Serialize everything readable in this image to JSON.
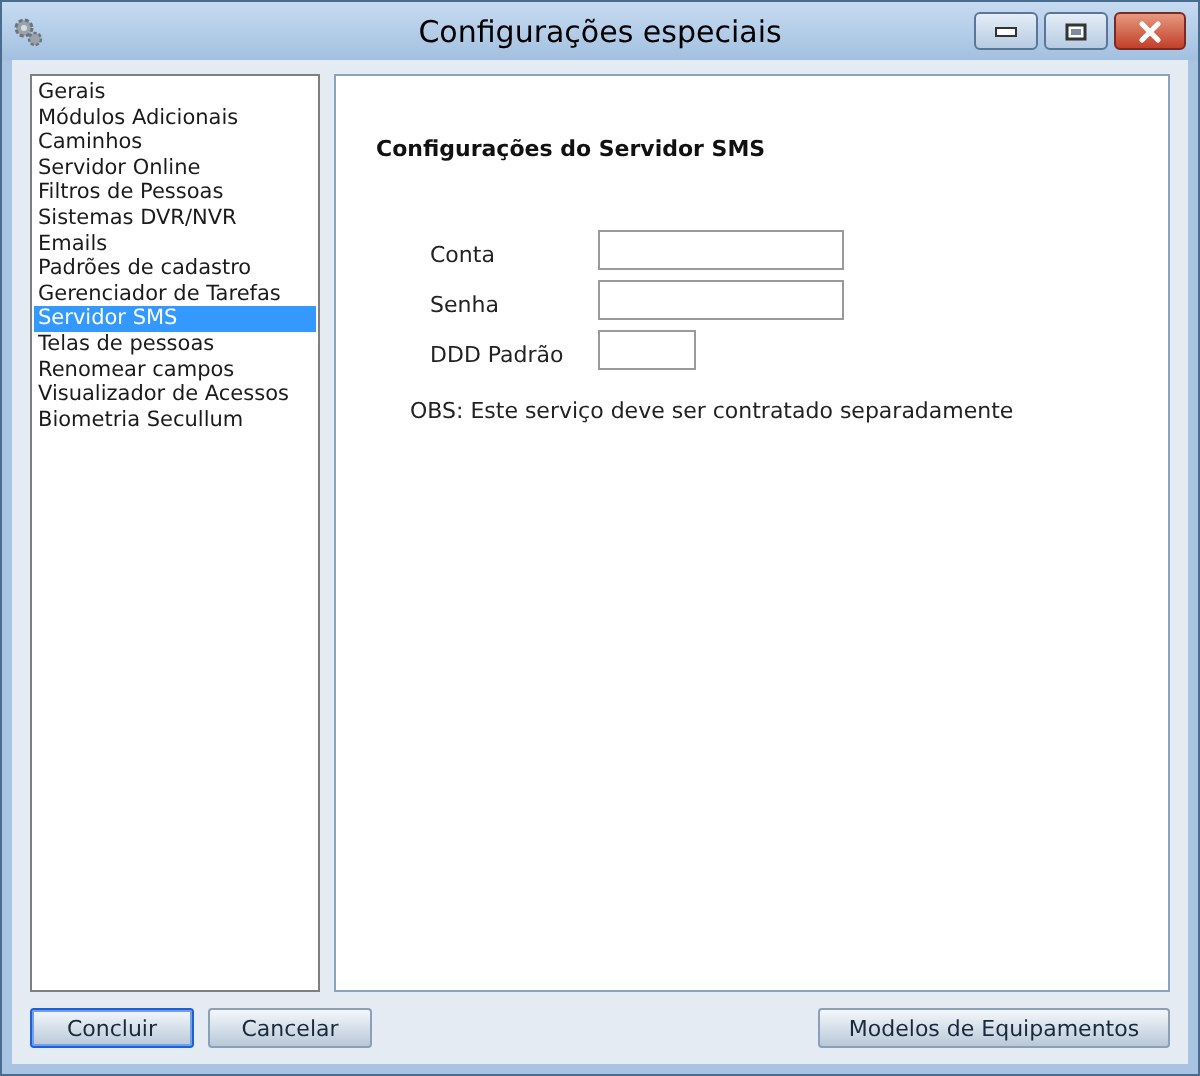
{
  "window": {
    "title": "Configurações especiais"
  },
  "sidebar": {
    "items": [
      {
        "label": "Gerais",
        "selected": false
      },
      {
        "label": "Módulos Adicionais",
        "selected": false
      },
      {
        "label": "Caminhos",
        "selected": false
      },
      {
        "label": "Servidor Online",
        "selected": false
      },
      {
        "label": "Filtros de Pessoas",
        "selected": false
      },
      {
        "label": "Sistemas DVR/NVR",
        "selected": false
      },
      {
        "label": "Emails",
        "selected": false
      },
      {
        "label": "Padrões de cadastro",
        "selected": false
      },
      {
        "label": "Gerenciador de Tarefas",
        "selected": false
      },
      {
        "label": "Servidor SMS",
        "selected": true
      },
      {
        "label": "Telas de pessoas",
        "selected": false
      },
      {
        "label": "Renomear campos",
        "selected": false
      },
      {
        "label": "Visualizador de Acessos",
        "selected": false
      },
      {
        "label": "Biometria Secullum",
        "selected": false
      }
    ]
  },
  "panel": {
    "heading": "Configurações do Servidor SMS",
    "fields": [
      {
        "label": "Conta",
        "kind": "wide"
      },
      {
        "label": "Senha",
        "kind": "wide"
      },
      {
        "label": "DDD Padrão",
        "kind": "short"
      }
    ],
    "note": "OBS: Este serviço deve ser contratado separadamente"
  },
  "buttons": [
    {
      "label": "Concluir",
      "focused": true
    },
    {
      "label": "Cancelar",
      "focused": false
    }
  ],
  "right_button": "Modelos de Equipamentos"
}
